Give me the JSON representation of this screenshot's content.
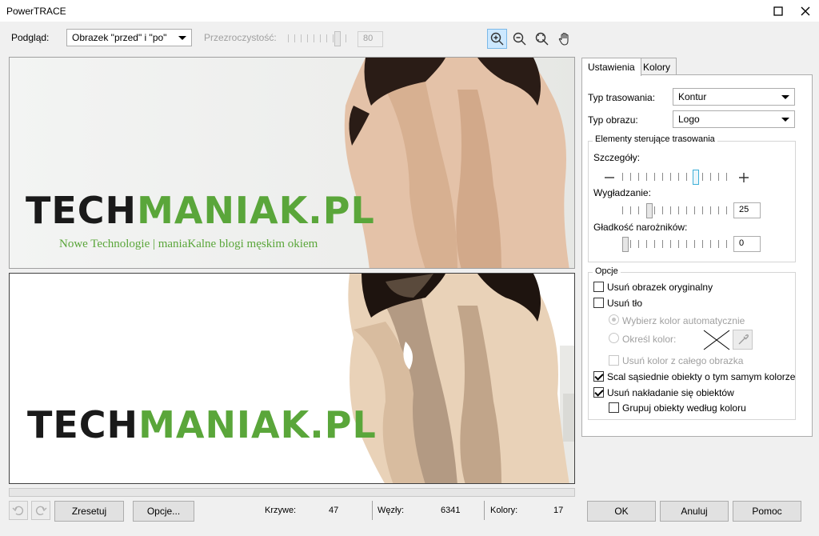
{
  "window": {
    "title": "PowerTRACE"
  },
  "toolbar": {
    "preview_label": "Podgląd:",
    "preview_value": "Obrazek \"przed\" i \"po\"",
    "transparency_label": "Przezroczystość:",
    "transparency_value": "80",
    "transparency_level_percent": 80
  },
  "preview": {
    "before": {
      "brand_part1": "TECH",
      "brand_part2": "MANIAK.PL",
      "tagline": "Nowe Technologie | maniaKalne blogi męskim okiem"
    },
    "after": {
      "brand_part1": "TECH",
      "brand_part2": "MANIAK.PL"
    }
  },
  "tabs": [
    {
      "label": "Ustawienia",
      "selected": true
    },
    {
      "label": "Kolory",
      "selected": false
    }
  ],
  "settings": {
    "trace_type_label": "Typ trasowania:",
    "trace_type_value": "Kontur",
    "image_type_label": "Typ obrazu:",
    "image_type_value": "Logo",
    "controls_group": "Elementy sterujące trasowania",
    "detail_label": "Szczegóły:",
    "detail_level_percent": 70,
    "smoothing_label": "Wygładzanie:",
    "smoothing_value": "25",
    "corner_label": "Gładkość narożników:",
    "corner_value": "0",
    "options_group": "Opcje",
    "opt_remove_original": "Usuń obrazek oryginalny",
    "opt_remove_bg": "Usuń tło",
    "opt_auto_color": "Wybierz kolor automatycznie",
    "opt_specify_color": "Określ kolor:",
    "opt_remove_whole": "Usuń kolor z całego obrazka",
    "opt_merge": "Scal sąsiednie obiekty o tym samym kolorze",
    "opt_remove_overlap": "Usuń nakładanie się obiektów",
    "opt_group_by_color": "Grupuj obiekty według koloru"
  },
  "footer": {
    "reset": "Zresetuj",
    "options": "Opcje...",
    "curves_label": "Krzywe:",
    "curves_value": "47",
    "nodes_label": "Węzły:",
    "nodes_value": "6341",
    "colors_label": "Kolory:",
    "colors_value": "17",
    "ok": "OK",
    "cancel": "Anuluj",
    "help": "Pomoc"
  },
  "colors": {
    "brand_green": "#5aa63a",
    "brand_dark": "#1a1a1a",
    "accent": "#3fb0d8"
  }
}
